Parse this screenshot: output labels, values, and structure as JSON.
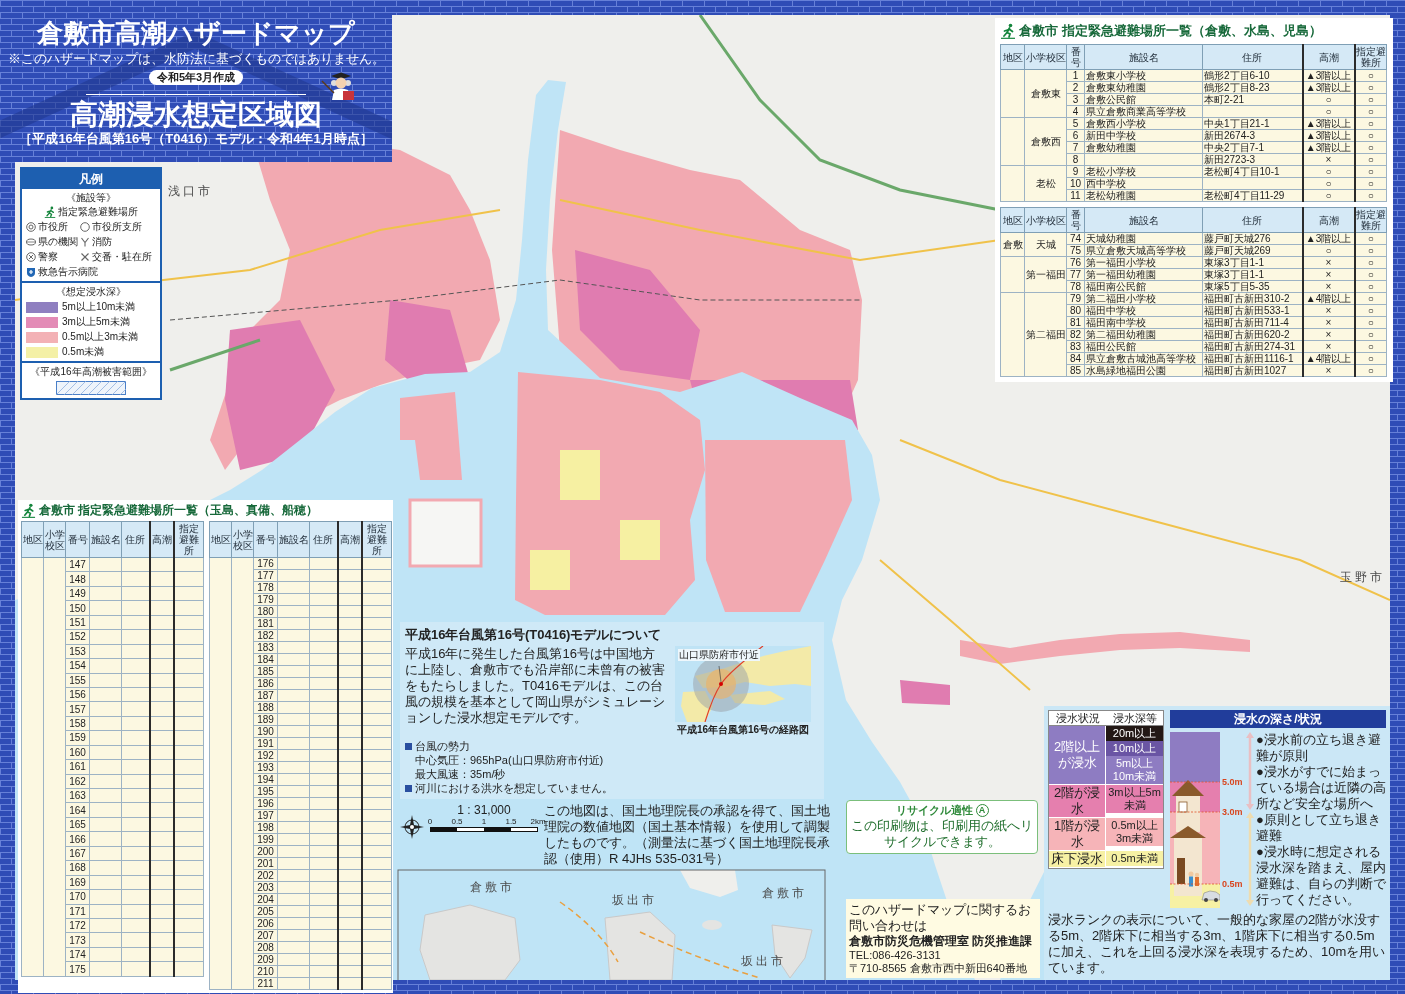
{
  "header": {
    "title": "倉敷市高潮ハザードマップ",
    "note": "※このハザードマップは、水防法に基づくものではありません。",
    "date": "令和5年3月作成",
    "map_title": "高潮浸水想定区域図",
    "model": "［平成16年台風第16号（T0416）モデル：令和4年1月時点］"
  },
  "legend": {
    "title": "凡例",
    "facilities_heading": "《施設等》",
    "facilities": [
      {
        "kind": "shelter",
        "label": "指定緊急避難場所"
      },
      {
        "kind": "city_hall",
        "label": "市役所"
      },
      {
        "kind": "branch",
        "label": "市役所支所"
      },
      {
        "kind": "prefecture",
        "label": "県の機関"
      },
      {
        "kind": "fire",
        "label": "消防"
      },
      {
        "kind": "police",
        "label": "警察"
      },
      {
        "kind": "koban",
        "label": "交番・駐在所"
      },
      {
        "kind": "hospital",
        "label": "救急告示病院"
      }
    ],
    "depth_heading": "《想定浸水深》",
    "depths": [
      {
        "label": "5m以上10m未満",
        "color": "#8f7fc0"
      },
      {
        "label": "3m以上5m未満",
        "color": "#e38bb6"
      },
      {
        "label": "0.5m以上3m未満",
        "color": "#f3b1b5"
      },
      {
        "label": "0.5m未満",
        "color": "#f4f0a6"
      }
    ],
    "damage_heading": "《平成16年高潮被害範囲》"
  },
  "map": {
    "area_labels": [
      "浅口市",
      "倉敷市",
      "坂出市",
      "倉敷市",
      "坂出市",
      "玉野市"
    ]
  },
  "north_table": {
    "title": "倉敷市 指定緊急避難場所一覧（倉敷、水島、児島）",
    "halves": [
      {
        "columns": [
          "地区",
          "小学校区",
          "番号",
          "施設名",
          "住所",
          "高潮",
          "指定避難所"
        ],
        "groups": [
          {
            "school": "倉敷東",
            "rows": [
              {
                "no": "1",
                "facility": "倉敷東小学校",
                "address": "鶴形2丁目6-10",
                "storm_surge": "▲3階以上",
                "shelter": "○"
              },
              {
                "no": "2",
                "facility": "倉敷東幼稚園",
                "address": "鶴形2丁目8-23",
                "storm_surge": "▲3階以上",
                "shelter": "○"
              },
              {
                "no": "3",
                "facility": "倉敷公民館",
                "address": "本町2-21",
                "storm_surge": "○",
                "shelter": "○"
              },
              {
                "no": "4",
                "facility": "県立倉敷商業高等学校",
                "storm_surge": "○",
                "shelter": "○"
              }
            ]
          },
          {
            "school": "倉敷西",
            "rows": [
              {
                "no": "5",
                "facility": "倉敷西小学校",
                "address": "中央1丁目21-1",
                "storm_surge": "▲3階以上",
                "shelter": "○"
              },
              {
                "no": "6",
                "facility": "新田中学校",
                "address": "新田2674-3",
                "storm_surge": "▲3階以上",
                "shelter": "○"
              },
              {
                "no": "7",
                "facility": "倉敷幼稚園",
                "address": "中央2丁目7-1",
                "storm_surge": "▲3階以上",
                "shelter": "○"
              },
              {
                "no": "8",
                "address": "新田2723-3",
                "storm_surge": "×",
                "shelter": "○"
              }
            ]
          },
          {
            "school": "老松",
            "rows": [
              {
                "no": "9",
                "facility": "老松小学校",
                "address": "老松町4丁目10-1",
                "storm_surge": "○",
                "shelter": "○"
              },
              {
                "no": "10",
                "facility": "西中学校",
                "storm_surge": "○",
                "shelter": "○"
              },
              {
                "no": "11",
                "facility": "老松幼稚園",
                "address": "老松町4丁目11-29",
                "storm_surge": "○",
                "shelter": "○"
              }
            ]
          }
        ]
      },
      {
        "columns": [
          "地区",
          "小学校区",
          "番号",
          "施設名",
          "住所",
          "高潮",
          "指定避難所"
        ],
        "groups": [
          {
            "district": "倉敷",
            "school": "天城",
            "rows": [
              {
                "no": "74",
                "facility": "天城幼稚園",
                "address": "藤戸町天城276",
                "storm_surge": "▲3階以上",
                "shelter": "○"
              },
              {
                "no": "75",
                "facility": "県立倉敷天城高等学校",
                "address": "藤戸町天城269",
                "storm_surge": "○",
                "shelter": "○"
              }
            ]
          },
          {
            "school": "第一福田",
            "rows": [
              {
                "no": "76",
                "facility": "第一福田小学校",
                "address": "東塚3丁目1-1",
                "storm_surge": "×",
                "shelter": "○"
              },
              {
                "no": "77",
                "facility": "第一福田幼稚園",
                "address": "東塚3丁目1-1",
                "storm_surge": "×",
                "shelter": "○"
              },
              {
                "no": "78",
                "facility": "福田南公民館",
                "address": "東塚5丁目5-35",
                "storm_surge": "×",
                "shelter": "○"
              }
            ]
          },
          {
            "school": "第二福田",
            "rows": [
              {
                "no": "79",
                "facility": "第二福田小学校",
                "address": "福田町古新田310-2",
                "storm_surge": "▲4階以上",
                "shelter": "○"
              },
              {
                "no": "80",
                "facility": "福田中学校",
                "address": "福田町古新田533-1",
                "storm_surge": "×",
                "shelter": "○"
              },
              {
                "no": "81",
                "facility": "福田南中学校",
                "address": "福田町古新田711-4",
                "storm_surge": "×",
                "shelter": "○"
              },
              {
                "no": "82",
                "facility": "第二福田幼稚園",
                "address": "福田町古新田620-2",
                "storm_surge": "×",
                "shelter": "○"
              },
              {
                "no": "83",
                "facility": "福田公民館",
                "address": "福田町古新田274-31",
                "storm_surge": "×",
                "shelter": "○"
              },
              {
                "no": "84",
                "facility": "県立倉敷古城池高等学校",
                "address": "福田町古新田1116-1",
                "storm_surge": "▲4階以上",
                "shelter": "○"
              },
              {
                "no": "85",
                "facility": "水島緑地福田公園",
                "address": "福田町古新田1027",
                "storm_surge": "×",
                "shelter": "○"
              }
            ]
          }
        ]
      }
    ]
  },
  "typhoon": {
    "title": "平成16年台風第16号(T0416)モデルについて",
    "body": "平成16年に発生した台風第16号は中国地方に上陸し、倉敷市でも沿岸部に未曾有の被害をもたらしました。T0416モデルは、この台風の規模を基本として岡山県がシミュレーションした浸水想定モデルです。",
    "bullets": [
      {
        "heading": "台風の勢力",
        "lines": [
          "中心気圧：965hPa(山口県防府市付近)",
          "最大風速：35m/秒"
        ]
      },
      {
        "heading": "河川における洪水を想定していません。"
      }
    ],
    "route_map": {
      "label": "山口県防府市付近",
      "caption": "平成16年台風第16号の経路図"
    }
  },
  "south_table": {
    "title": "倉敷市 指定緊急避難場所一覧（玉島、真備、船穂）",
    "halves": [
      {
        "columns": [
          "地区",
          "小学校区",
          "番号",
          "施設名",
          "住所",
          "高潮",
          "指定避難所"
        ],
        "groups": [
          {
            "rows": [
              {
                "no": "147"
              },
              {
                "no": "148"
              },
              {
                "no": "149"
              },
              {
                "no": "150"
              },
              {
                "no": "151"
              },
              {
                "no": "152"
              },
              {
                "no": "153"
              },
              {
                "no": "154"
              },
              {
                "no": "155"
              },
              {
                "no": "156"
              },
              {
                "no": "157"
              },
              {
                "no": "158"
              },
              {
                "no": "159"
              },
              {
                "no": "160"
              },
              {
                "no": "161"
              },
              {
                "no": "162"
              },
              {
                "no": "163"
              },
              {
                "no": "164"
              },
              {
                "no": "165"
              },
              {
                "no": "166"
              },
              {
                "no": "167"
              },
              {
                "no": "168"
              },
              {
                "no": "169"
              },
              {
                "no": "170"
              },
              {
                "no": "171"
              },
              {
                "no": "172"
              },
              {
                "no": "173"
              },
              {
                "no": "174"
              },
              {
                "no": "175"
              }
            ]
          }
        ]
      },
      {
        "columns": [
          "地区",
          "小学校区",
          "番号",
          "施設名",
          "住所",
          "高潮",
          "指定避難所"
        ],
        "groups": [
          {
            "rows": [
              {
                "no": "176"
              },
              {
                "no": "177"
              },
              {
                "no": "178"
              },
              {
                "no": "179"
              },
              {
                "no": "180"
              },
              {
                "no": "181"
              },
              {
                "no": "182"
              },
              {
                "no": "183"
              },
              {
                "no": "184"
              },
              {
                "no": "185"
              },
              {
                "no": "186"
              },
              {
                "no": "187"
              },
              {
                "no": "188"
              },
              {
                "no": "189"
              },
              {
                "no": "190"
              },
              {
                "no": "191"
              },
              {
                "no": "192"
              },
              {
                "no": "193"
              },
              {
                "no": "194"
              },
              {
                "no": "195"
              },
              {
                "no": "196"
              },
              {
                "no": "197"
              },
              {
                "no": "198"
              },
              {
                "no": "199"
              },
              {
                "no": "200"
              },
              {
                "no": "201"
              },
              {
                "no": "202"
              },
              {
                "no": "203"
              },
              {
                "no": "204"
              },
              {
                "no": "205"
              },
              {
                "no": "206"
              },
              {
                "no": "207"
              },
              {
                "no": "208"
              },
              {
                "no": "209"
              },
              {
                "no": "210"
              },
              {
                "no": "211"
              }
            ]
          }
        ]
      }
    ]
  },
  "scale": {
    "ratio": "1 : 31,000",
    "ticks": [
      "0",
      "0.5",
      "1",
      "1.5",
      "2km"
    ],
    "note": "この地図は、国土地理院長の承認を得て、国土地理院の数値地図（国土基本情報）を使用して調製したものです。（測量法に基づく国土地理院長承認（使用）R 4JHs 535-031号）"
  },
  "recycle": {
    "label": "リサイクル適性",
    "grade": "A",
    "note": "この印刷物は、印刷用の紙へリサイクルできます。"
  },
  "contact": {
    "intro": "このハザードマップに関するお問い合わせは",
    "office": "倉敷市防災危機管理室 防災推進課",
    "tel": "TEL:086-426-3131",
    "address": "〒710-8565 倉敷市西中新田640番地"
  },
  "depth_guide": {
    "title": "浸水の深さ/状況",
    "columns": [
      "浸水状況",
      "浸水深等"
    ],
    "groups": [
      {
        "situation": "2階以上が浸水",
        "levels": [
          {
            "label": "20m以上",
            "color": "#231815"
          },
          {
            "label": "10m以上",
            "color": "#6a55a4"
          },
          {
            "label": "5m以上10m未満",
            "color": "#8e7cc2"
          }
        ]
      },
      {
        "situation": "2階が浸水",
        "levels": [
          {
            "label": "3m以上5m未満",
            "color": "#e57fae"
          }
        ]
      },
      {
        "situation": "1階が浸水",
        "levels": [
          {
            "label": "0.5m以上3m未満",
            "color": "#f6b4b8"
          }
        ]
      },
      {
        "situation": "床下浸水",
        "levels": [
          {
            "label": "0.5m未満",
            "color": "#f7f1a4"
          }
        ]
      }
    ],
    "marks": [
      "5.0m",
      "3.0m",
      "0.5m"
    ],
    "upper_notes": [
      "●浸水前の立ち退き避難が原則",
      "●浸水がすでに始まっている場合は近隣の高所など安全な場所へ"
    ],
    "lower_notes": [
      "●原則として立ち退き避難",
      "●浸水時に想定される浸水深を踏まえ、屋内避難は、自らの判断で行ってください。"
    ],
    "footnote": "浸水ランクの表示について、一般的な家屋の2階が水没する5m、2階床下に相当する3m、1階床下に相当する0.5mに加え、これを上回る浸水深を表現するため、10mを用いています。"
  }
}
